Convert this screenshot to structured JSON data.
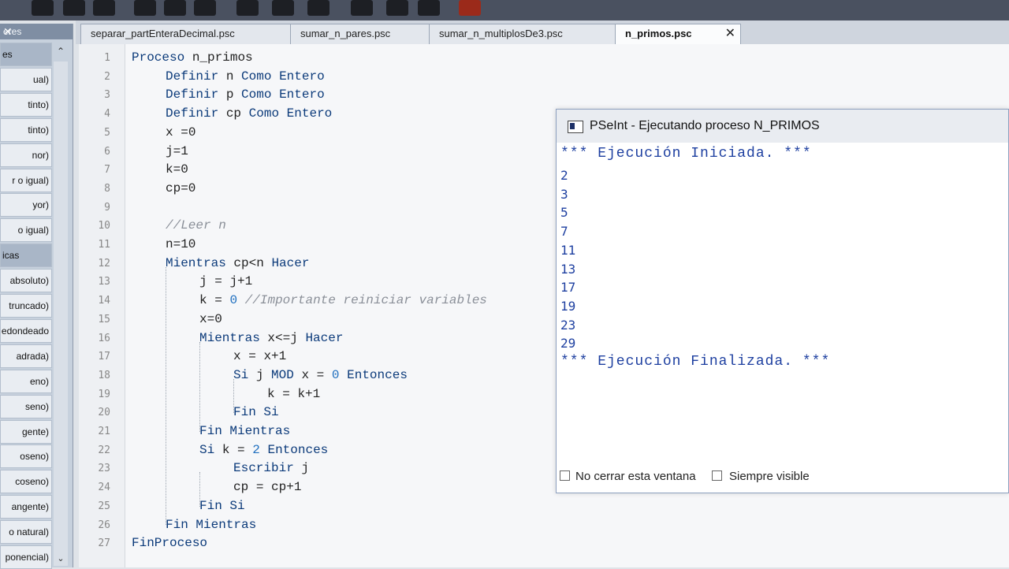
{
  "sidebar": {
    "items": [
      {
        "label": "es",
        "group": true
      },
      {
        "label": "ual)"
      },
      {
        "label": "tinto)"
      },
      {
        "label": "tinto)"
      },
      {
        "label": "nor)"
      },
      {
        "label": "r o igual)"
      },
      {
        "label": "yor)"
      },
      {
        "label": "o igual)"
      },
      {
        "label": "icas",
        "group": true
      },
      {
        "label": "absoluto)"
      },
      {
        "label": "truncado)"
      },
      {
        "label": "edondeado"
      },
      {
        "label": "adrada)"
      },
      {
        "label": "eno)"
      },
      {
        "label": "seno)"
      },
      {
        "label": "gente)"
      },
      {
        "label": "oseno)"
      },
      {
        "label": "coseno)"
      },
      {
        "label": "angente)"
      },
      {
        "label": "o natural)"
      },
      {
        "label": "ponencial)"
      }
    ]
  },
  "tabs": [
    {
      "label": "separar_partEnteraDecimal.psc"
    },
    {
      "label": "sumar_n_pares.psc"
    },
    {
      "label": "sumar_n_multiplosDe3.psc"
    },
    {
      "label": "n_primos.psc",
      "active": true
    }
  ],
  "editor": {
    "lines": [
      {
        "n": "1",
        "text": "Proceso n_primos"
      },
      {
        "n": "2",
        "text": "Definir n Como Entero"
      },
      {
        "n": "3",
        "text": "Definir p Como Entero"
      },
      {
        "n": "4",
        "text": "Definir cp Como Entero"
      },
      {
        "n": "5",
        "text": "x =0"
      },
      {
        "n": "6",
        "text": "j=1"
      },
      {
        "n": "7",
        "text": "k=0"
      },
      {
        "n": "8",
        "text": "cp=0"
      },
      {
        "n": "9",
        "text": ""
      },
      {
        "n": "10",
        "text": "//Leer n"
      },
      {
        "n": "11",
        "text": "n=10"
      },
      {
        "n": "12",
        "text": "Mientras cp<n Hacer"
      },
      {
        "n": "13",
        "text": "j = j+1"
      },
      {
        "n": "14",
        "text": "k = 0 //Importante reiniciar variables"
      },
      {
        "n": "15",
        "text": "x=0"
      },
      {
        "n": "16",
        "text": "Mientras x<=j Hacer"
      },
      {
        "n": "17",
        "text": "x = x+1"
      },
      {
        "n": "18",
        "text": "Si j MOD x = 0 Entonces"
      },
      {
        "n": "19",
        "text": "k = k+1"
      },
      {
        "n": "20",
        "text": "Fin Si"
      },
      {
        "n": "21",
        "text": "Fin Mientras"
      },
      {
        "n": "22",
        "text": "Si k = 2 Entonces"
      },
      {
        "n": "23",
        "text": "Escribir j"
      },
      {
        "n": "24",
        "text": "cp = cp+1"
      },
      {
        "n": "25",
        "text": "Fin Si"
      },
      {
        "n": "26",
        "text": "Fin Mientras"
      },
      {
        "n": "27",
        "text": "FinProceso"
      }
    ]
  },
  "output": {
    "title": "PSeInt - Ejecutando proceso N_PRIMOS",
    "start_banner": "*** Ejecución Iniciada. ***",
    "values": [
      "2",
      "3",
      "5",
      "7",
      "11",
      "13",
      "17",
      "19",
      "23",
      "29"
    ],
    "end_banner": "*** Ejecución Finalizada. ***",
    "no_close_label": "No cerrar esta ventana",
    "always_visible_label": "Siempre visible"
  }
}
